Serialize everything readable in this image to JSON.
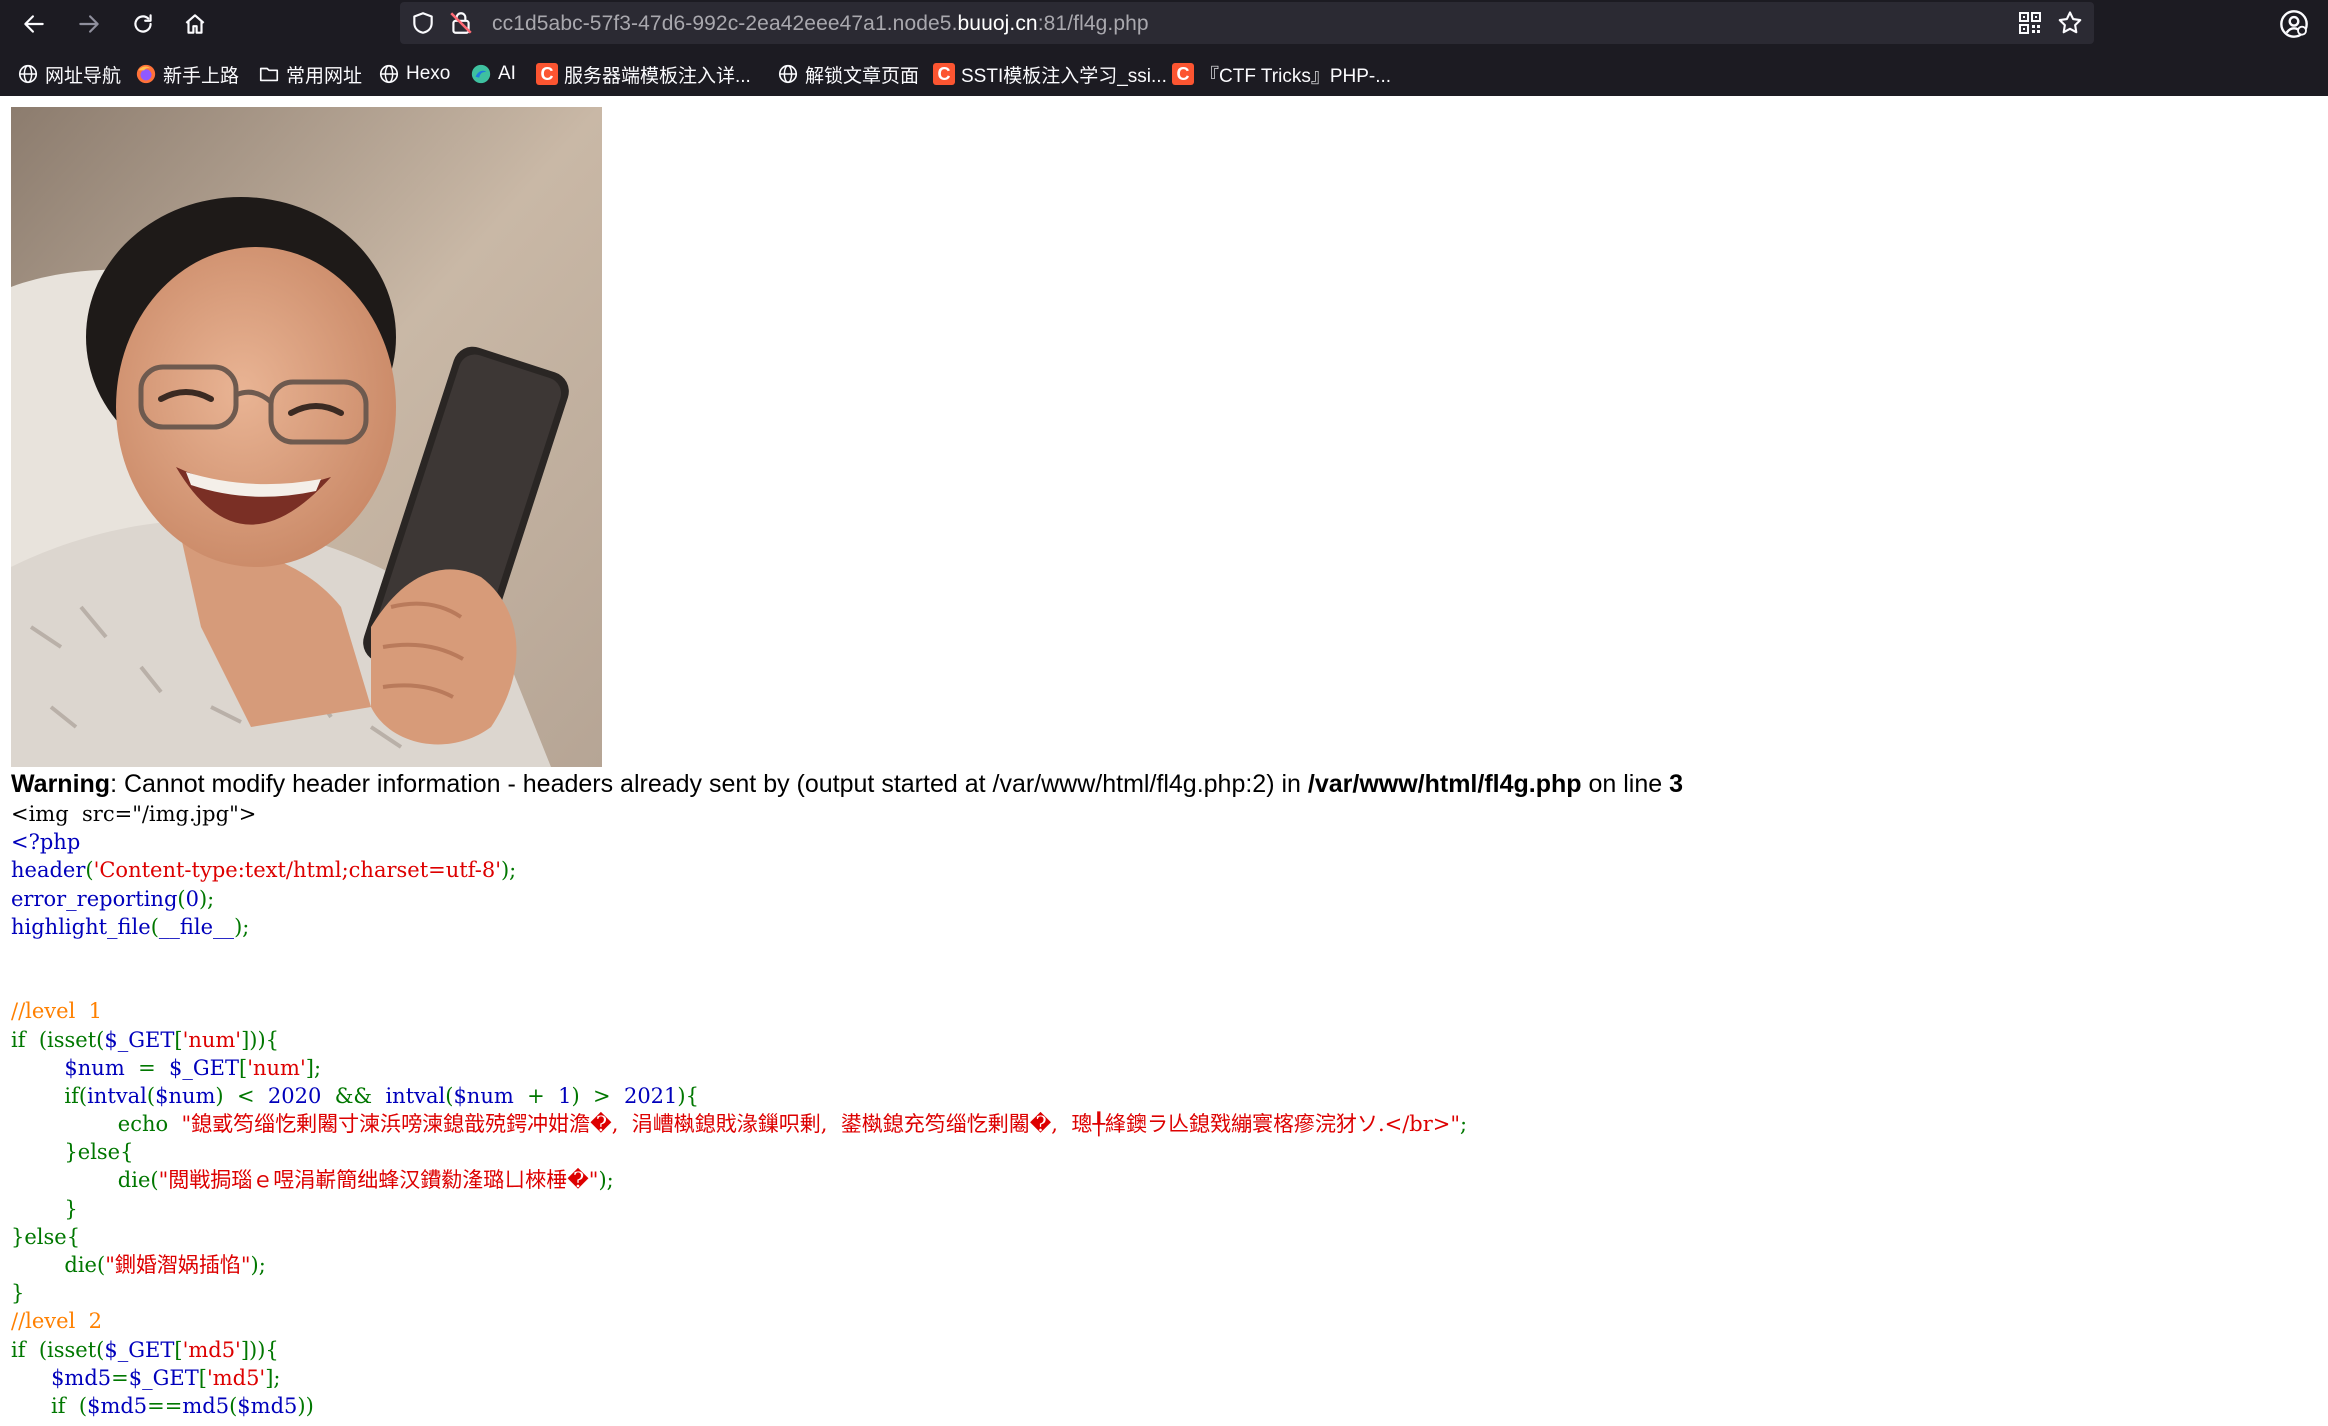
{
  "browser": {
    "url_prefix": "cc1d5abc-57f3-47d6-992c-2ea42eee47a1.node5.",
    "url_host": "buuoj.cn",
    "url_suffix": ":81/fl4g.php",
    "icons": {
      "back": "back-arrow-icon",
      "forward": "forward-arrow-icon",
      "reload": "reload-icon",
      "home": "home-icon",
      "shield": "tracking-shield-icon",
      "lock": "insecure-lock-icon",
      "qr": "qr-code-icon",
      "star": "bookmark-star-icon",
      "account": "account-icon"
    },
    "bookmarks": [
      {
        "label": "网址导航",
        "icon": "globe"
      },
      {
        "label": "新手上路",
        "icon": "firefox"
      },
      {
        "label": "常用网址",
        "icon": "folder"
      },
      {
        "label": "Hexo",
        "icon": "globe"
      },
      {
        "label": "AI",
        "icon": "ai"
      },
      {
        "label": "服务器端模板注入详...",
        "icon": "csdn"
      },
      {
        "label": "解锁文章页面",
        "icon": "globe"
      },
      {
        "label": "SSTI模板注入学习_ssi...",
        "icon": "csdn"
      },
      {
        "label": "『CTF Tricks』PHP-...",
        "icon": "csdn"
      }
    ]
  },
  "page": {
    "image_alt": "img.jpg",
    "warning": {
      "label": "Warning",
      "message": ": Cannot modify header information - headers already sent by (output started at /var/www/html/fl4g.php:2) in ",
      "file": "/var/www/html/fl4g.php",
      "on_line": " on line ",
      "line_no": "3"
    },
    "code_lines": [
      [
        {
          "c": "html",
          "t": "<img  src=\"/img.jpg\">"
        }
      ],
      [
        {
          "c": "kw",
          "t": "<?php"
        }
      ],
      [
        {
          "c": "kw",
          "t": "header"
        },
        {
          "c": "op",
          "t": "("
        },
        {
          "c": "str",
          "t": "'Content-type:text/html;charset=utf-8'"
        },
        {
          "c": "op",
          "t": ");"
        }
      ],
      [
        {
          "c": "kw",
          "t": "error_reporting"
        },
        {
          "c": "op",
          "t": "("
        },
        {
          "c": "kw",
          "t": "0"
        },
        {
          "c": "op",
          "t": ");"
        }
      ],
      [
        {
          "c": "kw",
          "t": "highlight_file"
        },
        {
          "c": "op",
          "t": "("
        },
        {
          "c": "kw",
          "t": "__file__"
        },
        {
          "c": "op",
          "t": ");"
        }
      ],
      [],
      [],
      [
        {
          "c": "cm",
          "t": "//level  1"
        }
      ],
      [
        {
          "c": "op",
          "t": "if  (isset("
        },
        {
          "c": "kw",
          "t": "$_GET"
        },
        {
          "c": "op",
          "t": "["
        },
        {
          "c": "str",
          "t": "'num'"
        },
        {
          "c": "op",
          "t": "])){"
        }
      ],
      [
        {
          "c": "op",
          "t": "        "
        },
        {
          "c": "kw",
          "t": "$num  "
        },
        {
          "c": "op",
          "t": "=  "
        },
        {
          "c": "kw",
          "t": "$_GET"
        },
        {
          "c": "op",
          "t": "["
        },
        {
          "c": "str",
          "t": "'num'"
        },
        {
          "c": "op",
          "t": "];"
        }
      ],
      [
        {
          "c": "op",
          "t": "        if("
        },
        {
          "c": "kw",
          "t": "intval"
        },
        {
          "c": "op",
          "t": "("
        },
        {
          "c": "kw",
          "t": "$num"
        },
        {
          "c": "op",
          "t": ")  <  "
        },
        {
          "c": "kw",
          "t": "2020  "
        },
        {
          "c": "op",
          "t": "&&  "
        },
        {
          "c": "kw",
          "t": "intval"
        },
        {
          "c": "op",
          "t": "("
        },
        {
          "c": "kw",
          "t": "$num  "
        },
        {
          "c": "op",
          "t": "+  "
        },
        {
          "c": "kw",
          "t": "1"
        },
        {
          "c": "op",
          "t": ")  >  "
        },
        {
          "c": "kw",
          "t": "2021"
        },
        {
          "c": "op",
          "t": "){"
        }
      ],
      [
        {
          "c": "op",
          "t": "                echo  "
        },
        {
          "c": "str",
          "t": "\"鎴戜笉缁忔剰闂寸湅浜嗙湅鎴戠殑鍔冲姏澹�,  涓嶆槸鎴戝湪鏁呮剰,  鍙槸鎴充笉缁忔剰闂�,  璁╀綘鐭ラ亾鎴戣繃寰楁瘮浣犲ソ.</br>\""
        },
        {
          "c": "op",
          "t": ";"
        }
      ],
      [
        {
          "c": "op",
          "t": "        }else{"
        }
      ],
      [
        {
          "c": "op",
          "t": "                die("
        },
        {
          "c": "str",
          "t": "\"閲戦挶瑙ｅ喅涓嶄簡绌蜂汉鐨勬湰璐ㄩ棶棰�\""
        },
        {
          "c": "op",
          "t": ");"
        }
      ],
      [
        {
          "c": "op",
          "t": "        }"
        }
      ],
      [
        {
          "c": "op",
          "t": "}else{"
        }
      ],
      [
        {
          "c": "op",
          "t": "        die("
        },
        {
          "c": "str",
          "t": "\"鍘婚潪娲插惂\""
        },
        {
          "c": "op",
          "t": ");"
        }
      ],
      [
        {
          "c": "op",
          "t": "}"
        }
      ],
      [
        {
          "c": "cm",
          "t": "//level  2"
        }
      ],
      [
        {
          "c": "op",
          "t": "if  (isset("
        },
        {
          "c": "kw",
          "t": "$_GET"
        },
        {
          "c": "op",
          "t": "["
        },
        {
          "c": "str",
          "t": "'md5'"
        },
        {
          "c": "op",
          "t": "])){"
        }
      ],
      [
        {
          "c": "op",
          "t": "      "
        },
        {
          "c": "kw",
          "t": "$md5"
        },
        {
          "c": "op",
          "t": "="
        },
        {
          "c": "kw",
          "t": "$_GET"
        },
        {
          "c": "op",
          "t": "["
        },
        {
          "c": "str",
          "t": "'md5'"
        },
        {
          "c": "op",
          "t": "];"
        }
      ],
      [
        {
          "c": "op",
          "t": "      if  ("
        },
        {
          "c": "kw",
          "t": "$md5"
        },
        {
          "c": "op",
          "t": "=="
        },
        {
          "c": "kw",
          "t": "md5"
        },
        {
          "c": "op",
          "t": "("
        },
        {
          "c": "kw",
          "t": "$md5"
        },
        {
          "c": "op",
          "t": "))"
        }
      ]
    ]
  }
}
